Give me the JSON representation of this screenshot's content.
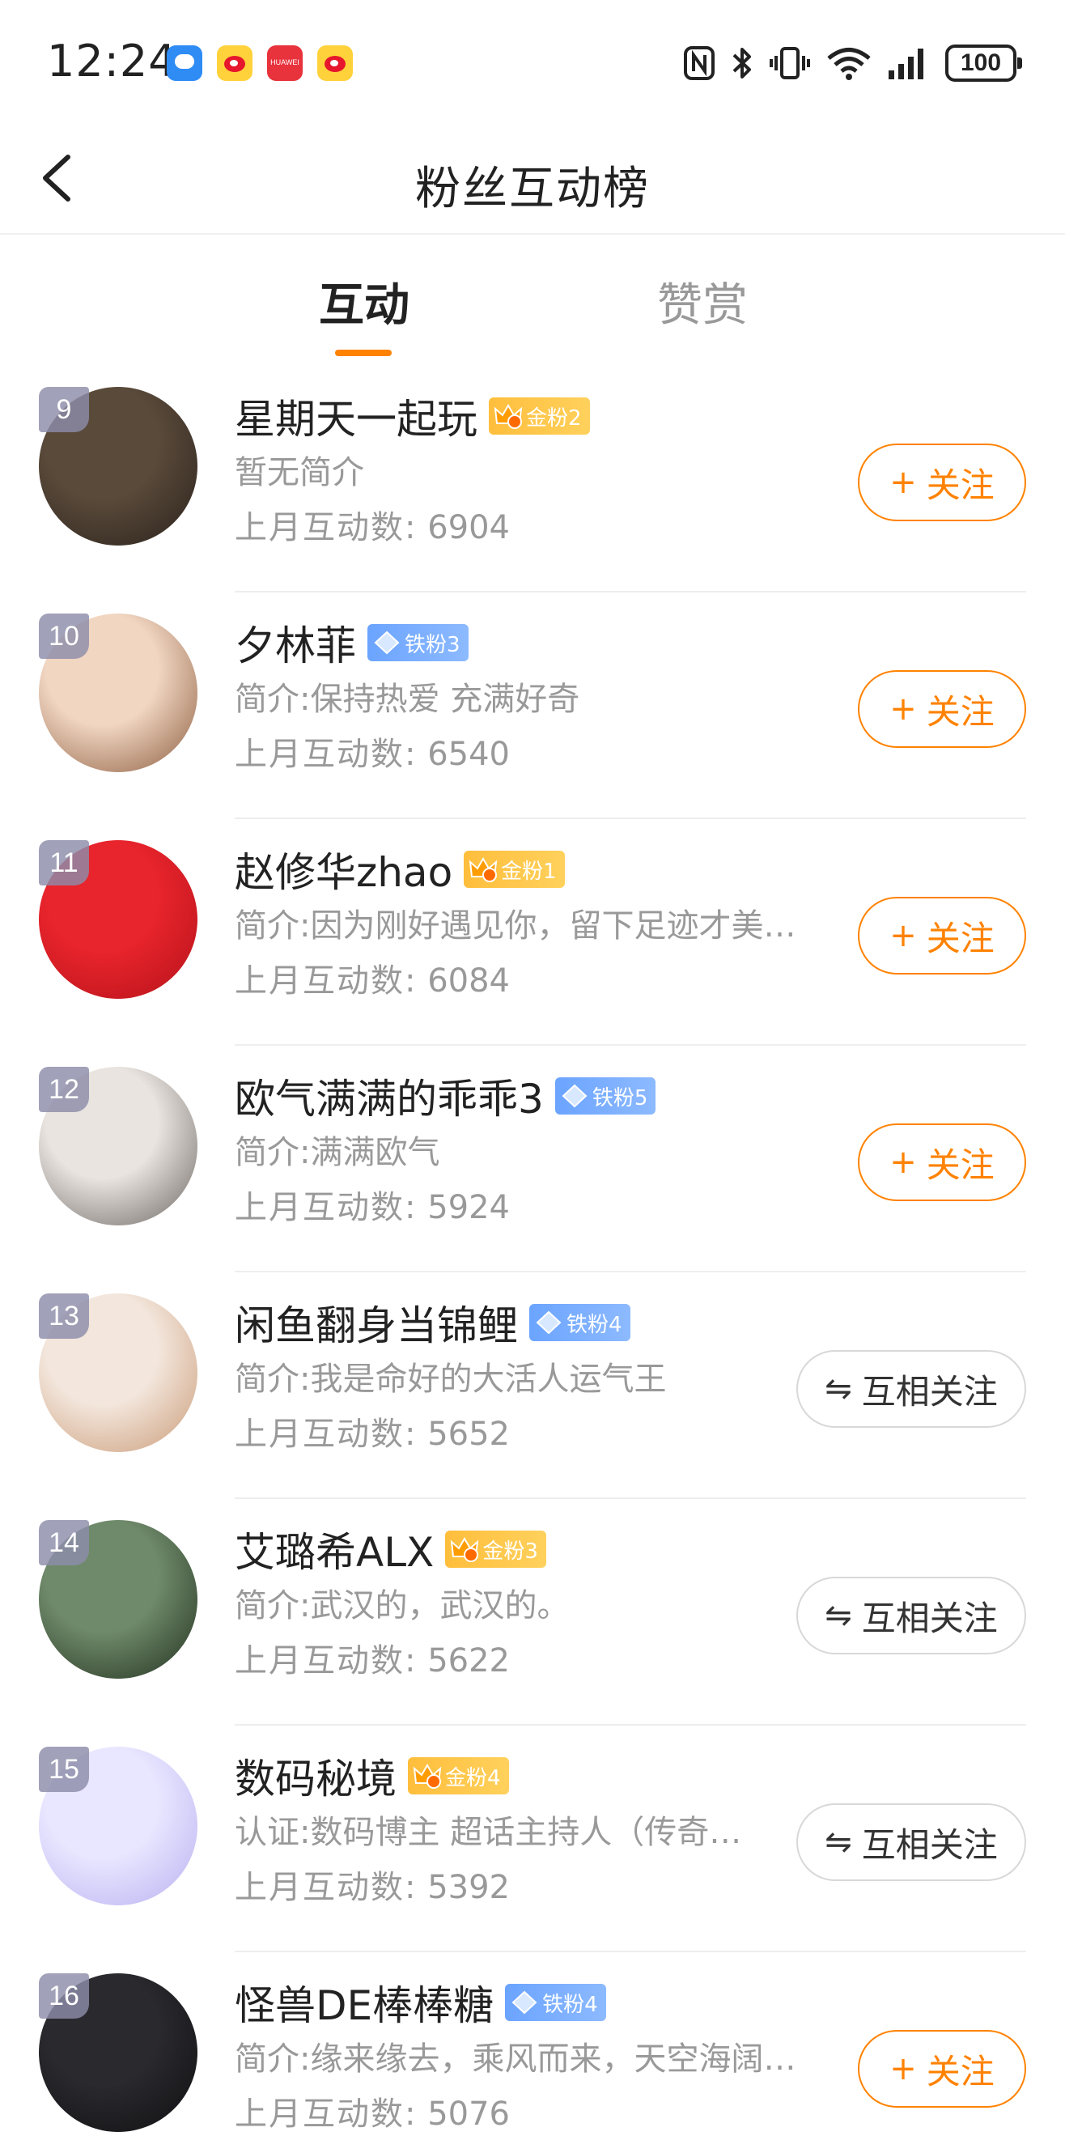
{
  "status_bar": {
    "time": "12:24",
    "battery": "100",
    "notification_icons": [
      "message-icon",
      "weibo-icon",
      "huawei-icon",
      "weibo-icon"
    ],
    "huawei_label": "HUAWEI"
  },
  "header": {
    "title": "粉丝互动榜",
    "back_icon": "chevron-left-icon"
  },
  "tabs": [
    {
      "label": "互动",
      "active": true
    },
    {
      "label": "赞赏",
      "active": false
    }
  ],
  "fans_list": [
    {
      "rank": "9",
      "name": "星期天一起玩",
      "badge": "金粉2",
      "badge_type": "gold",
      "bio": "暂无简介",
      "count_label": "上月互动数:",
      "count": "6904",
      "button": "关注",
      "button_type": "follow"
    },
    {
      "rank": "10",
      "name": "夕林菲",
      "badge": "铁粉3",
      "badge_type": "iron",
      "bio": "简介:保持热爱 充满好奇",
      "count_label": "上月互动数:",
      "count": "6540",
      "button": "关注",
      "button_type": "follow"
    },
    {
      "rank": "11",
      "name": "赵修华zhao",
      "badge": "金粉1",
      "badge_type": "gold",
      "bio": "简介:因为刚好遇见你，留下足迹才美…",
      "count_label": "上月互动数:",
      "count": "6084",
      "button": "关注",
      "button_type": "follow"
    },
    {
      "rank": "12",
      "name": "欧气满满的乖乖3",
      "badge": "铁粉5",
      "badge_type": "iron",
      "bio": "简介:满满欧气",
      "count_label": "上月互动数:",
      "count": "5924",
      "button": "关注",
      "button_type": "follow"
    },
    {
      "rank": "13",
      "name": "闲鱼翻身当锦鲤",
      "badge": "铁粉4",
      "badge_type": "iron",
      "bio": "简介:我是命好的大活人运气王",
      "count_label": "上月互动数:",
      "count": "5652",
      "button": "互相关注",
      "button_type": "mutual"
    },
    {
      "rank": "14",
      "name": "艾璐希ALX",
      "badge": "金粉3",
      "badge_type": "gold",
      "bio": "简介:武汉的，武汉的。",
      "count_label": "上月互动数:",
      "count": "5622",
      "button": "互相关注",
      "button_type": "mutual"
    },
    {
      "rank": "15",
      "name": "数码秘境",
      "badge": "金粉4",
      "badge_type": "gold",
      "bio": "认证:数码博主 超话主持人（传奇…",
      "count_label": "上月互动数:",
      "count": "5392",
      "button": "互相关注",
      "button_type": "mutual"
    },
    {
      "rank": "16",
      "name": "怪兽DE棒棒糖",
      "badge": "铁粉4",
      "badge_type": "iron",
      "bio": "简介:缘来缘去，乘风而来，天空海阔…",
      "count_label": "上月互动数:",
      "count": "5076",
      "button": "关注",
      "button_type": "follow"
    }
  ],
  "avatar_colors": [
    [
      "#5a4a3a",
      "#2a221c"
    ],
    [
      "#f1d6c2",
      "#8a5a3c"
    ],
    [
      "#e8242c",
      "#b5121a"
    ],
    [
      "#e9e4df",
      "#6a6460"
    ],
    [
      "#f3e6dc",
      "#c99a76"
    ],
    [
      "#6f8a6a",
      "#22301f"
    ],
    [
      "#e9e6ff",
      "#b8b0f0"
    ],
    [
      "#2a2a2e",
      "#0f0f12"
    ]
  ],
  "colors": {
    "accent": "#ff8200",
    "gold_badge": "#ffbe3c",
    "iron_badge": "#6ba4ff",
    "muted_text": "#999999"
  }
}
